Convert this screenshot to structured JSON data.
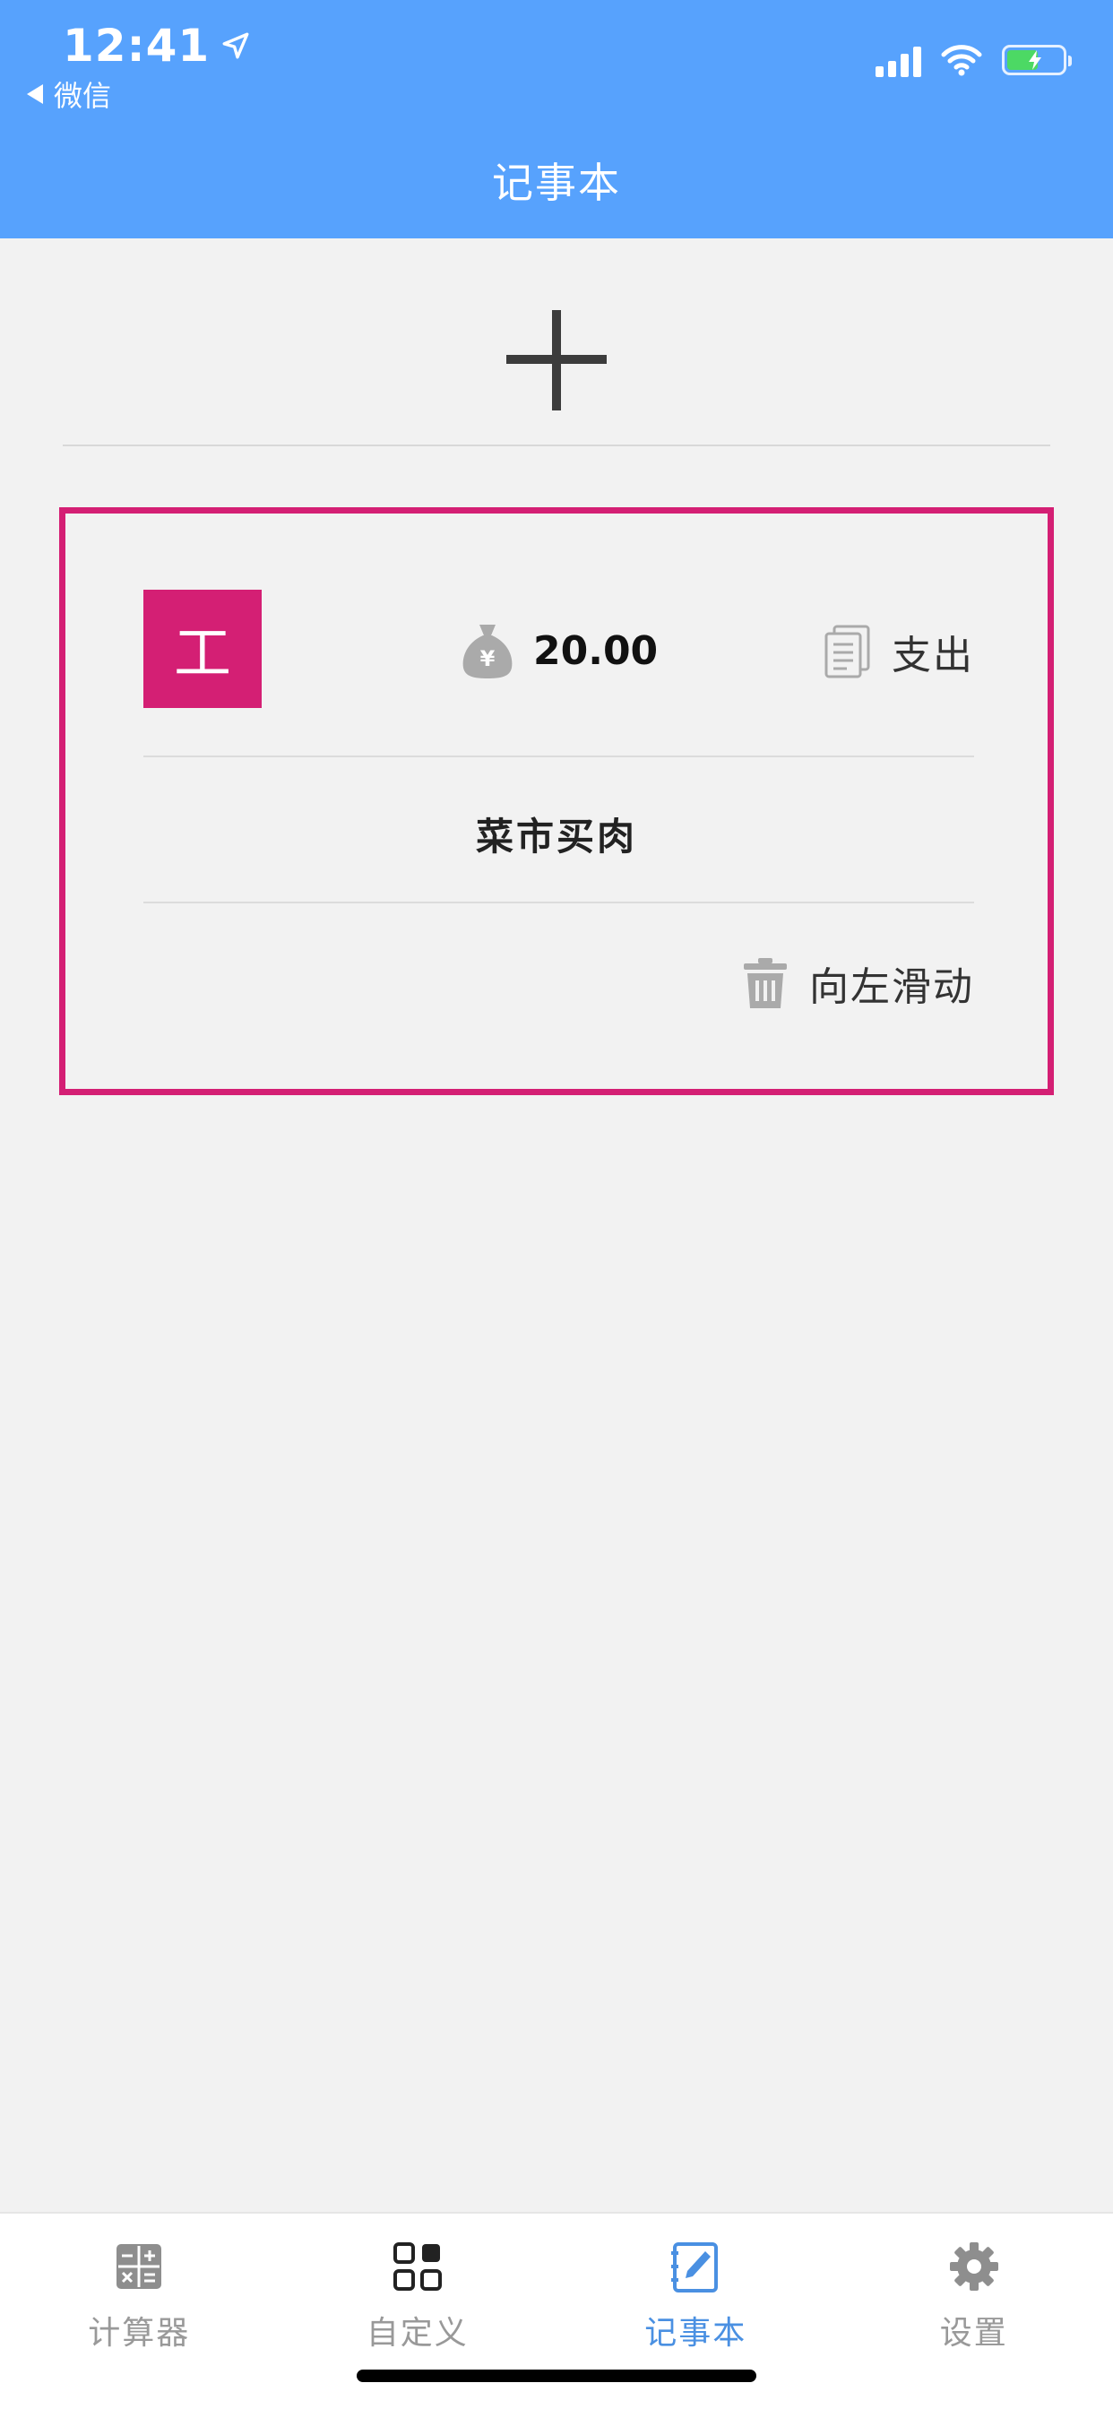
{
  "status_bar": {
    "time": "12:41",
    "back_label": "微信"
  },
  "header": {
    "title": "记事本"
  },
  "record": {
    "category_char": "工",
    "amount": "20.00",
    "type": "支出",
    "note": "菜市买肉",
    "swipe_hint": "向左滑动",
    "accent_color": "#d41f74"
  },
  "tabbar": {
    "tabs": [
      {
        "label": "计算器",
        "icon": "calculator-icon"
      },
      {
        "label": "自定义",
        "icon": "grid-icon"
      },
      {
        "label": "记事本",
        "icon": "notebook-icon",
        "active": true
      },
      {
        "label": "设置",
        "icon": "gear-icon"
      }
    ],
    "active_color": "#4a90e2"
  },
  "colors": {
    "header": "#57a2fd",
    "background": "#f2f2f2"
  }
}
